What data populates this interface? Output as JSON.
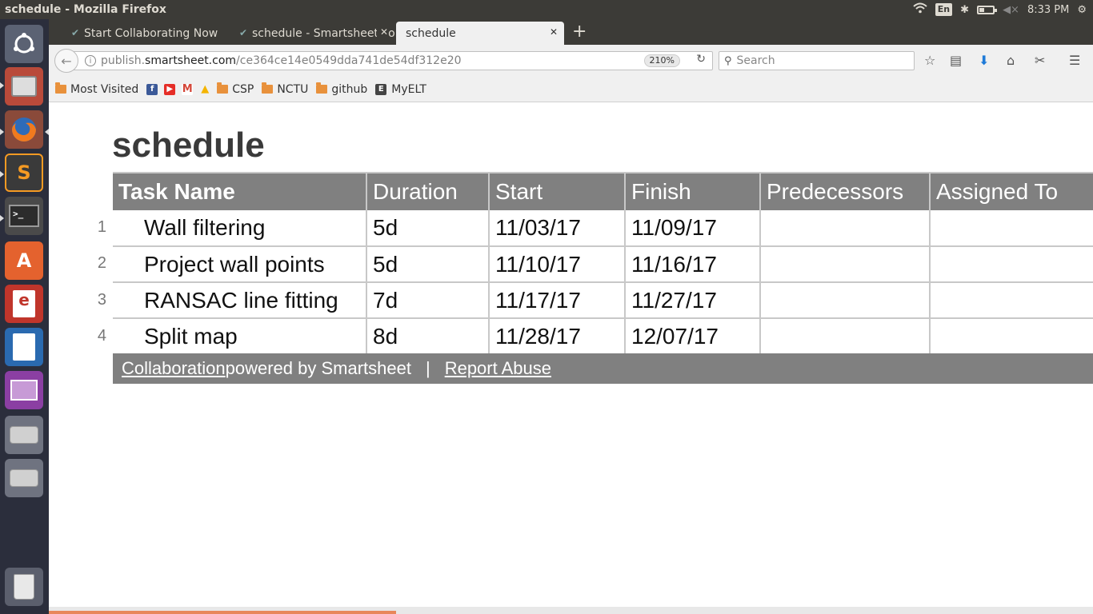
{
  "system": {
    "window_title": "schedule - Mozilla Firefox",
    "keyboard_layout": "En",
    "clock": "8:33 PM"
  },
  "tabs": [
    {
      "label": "Start Collaborating Now"
    },
    {
      "label": "schedule - Smartsheet.com"
    },
    {
      "label": "schedule",
      "active": true
    }
  ],
  "navbar": {
    "url_host_prefix": "publish.",
    "url_host_domain": "smartsheet.com",
    "url_path": "/ce364ce14e0549dda741de54df312e20",
    "zoom": "210%",
    "search_placeholder": "Search"
  },
  "bookmarks": [
    {
      "label": "Most Visited"
    },
    {
      "label": "CSP"
    },
    {
      "label": "NCTU"
    },
    {
      "label": "github"
    },
    {
      "label": "MyELT"
    }
  ],
  "page": {
    "title": "schedule",
    "columns": [
      "Task Name",
      "Duration",
      "Start",
      "Finish",
      "Predecessors",
      "Assigned To"
    ],
    "rows": [
      {
        "num": "1",
        "task": "Wall filtering",
        "duration": "5d",
        "start": "11/03/17",
        "finish": "11/09/17",
        "predecessors": "",
        "assigned": ""
      },
      {
        "num": "2",
        "task": "Project wall points",
        "duration": "5d",
        "start": "11/10/17",
        "finish": "11/16/17",
        "predecessors": "",
        "assigned": ""
      },
      {
        "num": "3",
        "task": "RANSAC line fitting",
        "duration": "7d",
        "start": "11/17/17",
        "finish": "11/27/17",
        "predecessors": "",
        "assigned": ""
      },
      {
        "num": "4",
        "task": "Split map",
        "duration": "8d",
        "start": "11/28/17",
        "finish": "12/07/17",
        "predecessors": "",
        "assigned": ""
      }
    ],
    "footer": {
      "collab_link": "Collaboration",
      "powered": " powered by Smartsheet",
      "separator": "|",
      "report_link": "Report Abuse"
    }
  },
  "icons": {
    "launcher": [
      "ubuntu-dash-icon",
      "file-manager-icon",
      "firefox-icon",
      "sublime-text-icon",
      "terminal-icon",
      "software-center-icon",
      "document-viewer-icon",
      "libreoffice-writer-icon",
      "libreoffice-impress-icon",
      "disk-drive-icon",
      "disk-drive-icon",
      "trash-icon"
    ]
  },
  "colors": {
    "header_bg": "#808080",
    "grid_line": "#c8c8c8",
    "title_text": "#3a3a3a"
  }
}
